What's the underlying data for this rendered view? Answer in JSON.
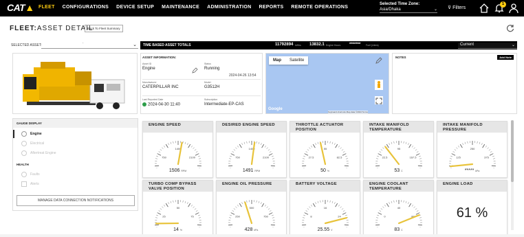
{
  "header": {
    "logo": "CAT",
    "nav": [
      "FLEET",
      "CONFIGURATIONS",
      "DEVICE SETUP",
      "MAINTENANCE",
      "ADMINISTRATION",
      "REPORTS",
      "REMOTE OPERATIONS"
    ],
    "active_nav": "FLEET",
    "timezone_label": "Selected Time Zone:",
    "timezone_value": "Asia/Dhaka",
    "filters_label": "Filters",
    "notification_count": "1",
    "accent_color": "#FFCD11"
  },
  "page": {
    "title_prefix": "FLEET:",
    "title": "ASSET DETAIL",
    "back_button": "Back To Fleet Summary",
    "selected_asset_label": "SELECTED ASSET:",
    "selected_asset_value": "·"
  },
  "totals": {
    "label": "TIME BASED ASSET TOTALS",
    "kwh_value": "11792894",
    "kwh_unit": "kWhs",
    "hours_value": "13832.1",
    "hours_unit": "Engine Hours",
    "fuel_value": "*******",
    "fuel_unit": "Fuel (Liters)",
    "period": "Current"
  },
  "asset_info": {
    "heading": "ASSET INFORMATION:",
    "asset_id_label": "Asset ID",
    "asset_id": "Engine",
    "status_label": "Status",
    "status": "Running",
    "status_time": "2024-04-26 13:54",
    "manufacturer_label": "Manufacturer",
    "manufacturer": "CATERPILLAR INC",
    "model_label": "Model",
    "model": "G3512H",
    "last_reported_label": "Last Reported Date",
    "last_reported": "2024-04-30 11:40",
    "subscription_label": "Subscription",
    "subscription": "Intermediate-EP-CAS"
  },
  "map": {
    "tab_map": "Map",
    "tab_satellite": "Satellite",
    "google": "Google",
    "credits": "Keyboard shortcuts   Map data ©2024   Terms"
  },
  "notes": {
    "heading": "NOTES",
    "add_button": "Add Note"
  },
  "sidebar": {
    "gauge_heading": "GAUGE DISPLAY",
    "gauge_items": [
      "Engine",
      "Electrical",
      "Aftertreat Engine"
    ],
    "health_heading": "HEALTH",
    "health_items": [
      "Faults",
      "Alerts"
    ],
    "manage_button": "MANAGE DATA CONNECTION NOTIFICATIONS"
  },
  "gauges": [
    {
      "title": "ENGINE SPEED",
      "ticks": [
        "750",
        "1400",
        "2100",
        "0",
        "2800"
      ],
      "value": "1506",
      "unit": "RPM",
      "fraction": 0.54
    },
    {
      "title": "DESIRED ENGINE SPEED",
      "ticks": [
        "750",
        "1400",
        "2100",
        "0",
        "2800"
      ],
      "value": "1491",
      "unit": "RPM",
      "fraction": 0.53
    },
    {
      "title": "THROTTLE ACTUATOR POSITION",
      "ticks": [
        "27.5",
        "55",
        "82.5",
        "0",
        "110"
      ],
      "value": "50",
      "unit": "%",
      "fraction": 0.45
    },
    {
      "title": "INTAKE MANIFOLD TEMPERATURE",
      "ticks": [
        "22.5",
        "95",
        "167.5",
        "-50",
        "240"
      ],
      "value": "53",
      "unit": "C",
      "fraction": 0.35
    },
    {
      "title": "INTAKE MANIFOLD PRESSURE",
      "ticks": [
        "125",
        "250",
        "375",
        "0",
        "500"
      ],
      "value": "*****",
      "unit": "kPa",
      "fraction": 0.12
    },
    {
      "title": "TURBO COMP BYPASS VALVE POSITION",
      "ticks": [
        "25",
        "50",
        "75",
        "0",
        "100"
      ],
      "value": "14",
      "unit": "%",
      "fraction": 0.14
    },
    {
      "title": "ENGINE OIL PRESSURE",
      "ticks": [
        "250",
        "500",
        "750",
        "0",
        "1000"
      ],
      "value": "428",
      "unit": "kPa",
      "fraction": 0.43
    },
    {
      "title": "BATTERY VOLTAGE",
      "ticks": [
        "8",
        "16",
        "24",
        "0",
        "32"
      ],
      "value": "25.55",
      "unit": "V",
      "fraction": 0.8
    },
    {
      "title": "ENGINE COOLANT TEMPERATURE",
      "ticks": [
        "0",
        "40",
        "80",
        "-40",
        "120"
      ],
      "value": "83",
      "unit": "C",
      "fraction": 0.77
    },
    {
      "title": "ENGINE LOAD",
      "value": "61 %",
      "big": true
    }
  ]
}
